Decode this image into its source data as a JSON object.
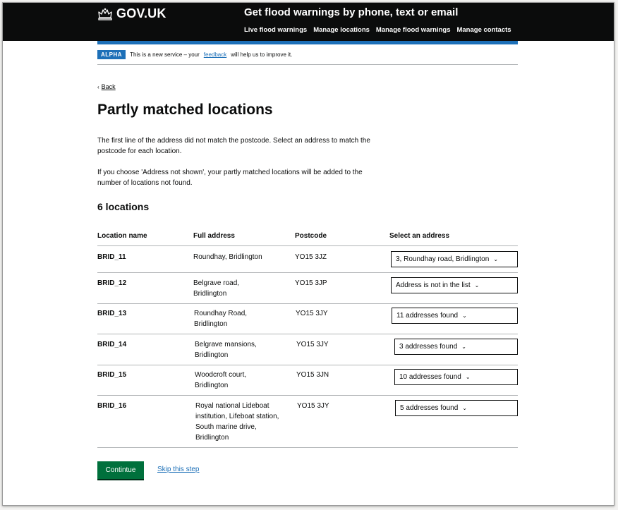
{
  "header": {
    "logo_text": "GOV.UK",
    "service_name": "Get flood warnings by phone, text or email",
    "nav": [
      "Live flood warnings",
      "Manage locations",
      "Manage flood warnings",
      "Manage contacts"
    ]
  },
  "phase_banner": {
    "tag": "ALPHA",
    "text_before": "This is a new service – your",
    "link": "feedback",
    "text_after": "will help us to improve it."
  },
  "back_link": "Back",
  "page_title": "Partly matched locations",
  "intro": [
    "The first line of the address did not match the postcode. Select an address to match the postcode for each location.",
    "If you choose 'Address not shown', your partly matched locations will be added to the number of locations not found."
  ],
  "count_heading": "6 locations",
  "table": {
    "headers": [
      "Location name",
      "Full address",
      "Postcode",
      "Select an address"
    ],
    "rows": [
      {
        "name": "BRID_11",
        "address": "Roundhay, Bridlington",
        "postcode": "YO15 3JZ",
        "select": "3, Roundhay road, Bridlington"
      },
      {
        "name": "BRID_12",
        "address": "Belgrave road, Bridlington",
        "postcode": "YO15 3JP",
        "select": "Address is not in the list"
      },
      {
        "name": "BRID_13",
        "address": "Roundhay Road, Bridlington",
        "postcode": "YO15 3JY",
        "select": "11 addresses found"
      },
      {
        "name": "BRID_14",
        "address": "Belgrave mansions, Bridlington",
        "postcode": "YO15 3JY",
        "select": "3 addresses found"
      },
      {
        "name": "BRID_15",
        "address": "Woodcroft court, Bridlington",
        "postcode": "YO15 3JN",
        "select": "10 addresses found"
      },
      {
        "name": "BRID_16",
        "address": "Royal national Lideboat institution, Lifeboat station, South marine drive, Bridlington",
        "postcode": "YO15 3JY",
        "select": "5 addresses found"
      }
    ]
  },
  "continue_label": "Contintue",
  "skip_label": "Skip this step",
  "colors": {
    "header_bg": "#0b0c0c",
    "accent_blue": "#1d70b8",
    "button_green": "#00703c"
  },
  "icons": {
    "logo": "crown-icon",
    "back": "chevron-left-icon",
    "select": "chevron-down-icon"
  }
}
